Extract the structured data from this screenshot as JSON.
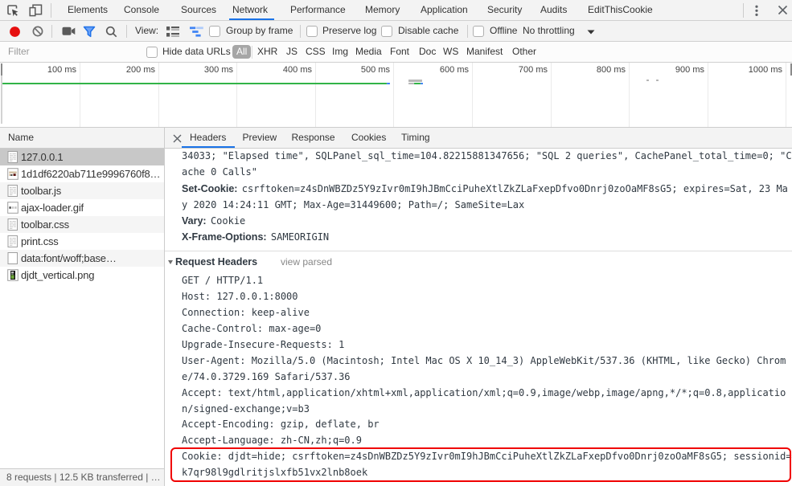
{
  "main_tabs": {
    "tabs": [
      "Elements",
      "Console",
      "Sources",
      "Network",
      "Performance",
      "Memory",
      "Application",
      "Security",
      "Audits",
      "EditThisCookie"
    ],
    "active": "Network"
  },
  "toolbar": {
    "view_label": "View:",
    "group_by_frame": "Group by frame",
    "preserve_log": "Preserve log",
    "disable_cache": "Disable cache",
    "offline": "Offline",
    "throttling": "No throttling"
  },
  "filter_bar": {
    "placeholder": "Filter",
    "hide_data_urls": "Hide data URLs",
    "types": [
      "All",
      "XHR",
      "JS",
      "CSS",
      "Img",
      "Media",
      "Font",
      "Doc",
      "WS",
      "Manifest",
      "Other"
    ],
    "active_type": "All"
  },
  "overview": {
    "ruler_labels": [
      "100 ms",
      "200 ms",
      "300 ms",
      "400 ms",
      "500 ms",
      "600 ms",
      "700 ms",
      "800 ms",
      "900 ms",
      "1000 ms"
    ]
  },
  "sidebar": {
    "header": "Name",
    "requests": [
      {
        "name": "127.0.0.1",
        "icon": "document",
        "selected": true
      },
      {
        "name": "1d1df6220ab711e9996760f8…",
        "icon": "image-photo",
        "selected": false
      },
      {
        "name": "toolbar.js",
        "icon": "document",
        "selected": false
      },
      {
        "name": "ajax-loader.gif",
        "icon": "image-loader",
        "selected": false
      },
      {
        "name": "toolbar.css",
        "icon": "document",
        "selected": false
      },
      {
        "name": "print.css",
        "icon": "document",
        "selected": false
      },
      {
        "name": "data:font/woff;base…",
        "icon": "blank",
        "selected": false
      },
      {
        "name": "djdt_vertical.png",
        "icon": "image-dark",
        "selected": false
      }
    ],
    "summary": "8 requests | 12.5 KB transferred | …"
  },
  "details": {
    "tabs": [
      "Headers",
      "Preview",
      "Response",
      "Cookies",
      "Timing"
    ],
    "active": "Headers",
    "response_lines": [
      {
        "text": "34033; \"Elapsed time\", SQLPanel_sql_time=104.82215881347656; \"SQL 2 queries\", CachePanel_total_time=0; \"C"
      },
      {
        "text": "ache 0 Calls\""
      },
      {
        "name": "Set-Cookie:",
        "text": "csrftoken=z4sDnWBZDz5Y9zIvr0mI9hJBmCciPuheXtlZkZLaFxepDfvo0Dnrj0zoOaMF8sG5; expires=Sat, 23 Ma"
      },
      {
        "text": "y 2020 14:24:11 GMT; Max-Age=31449600; Path=/; SameSite=Lax"
      },
      {
        "name": "Vary:",
        "text": "Cookie"
      },
      {
        "name": "X-Frame-Options:",
        "text": "SAMEORIGIN"
      }
    ],
    "request_section": {
      "title": "Request Headers",
      "link": "view parsed"
    },
    "request_lines": [
      "GET / HTTP/1.1",
      "Host: 127.0.0.1:8000",
      "Connection: keep-alive",
      "Cache-Control: max-age=0",
      "Upgrade-Insecure-Requests: 1",
      "User-Agent: Mozilla/5.0 (Macintosh; Intel Mac OS X 10_14_3) AppleWebKit/537.36 (KHTML, like Gecko) Chrom",
      "e/74.0.3729.169 Safari/537.36",
      "Accept: text/html,application/xhtml+xml,application/xml;q=0.9,image/webp,image/apng,*/*;q=0.8,applicatio",
      "n/signed-exchange;v=b3",
      "Accept-Encoding: gzip, deflate, br",
      "Accept-Language: zh-CN,zh;q=0.9",
      "Cookie: djdt=hide; csrftoken=z4sDnWBZDz5Y9zIvr0mI9hJBmCciPuheXtlZkZLaFxepDfvo0Dnrj0zoOaMF8sG5; sessionid=",
      "k7qr98l9gdlritjslxfb51vx2lnb8oek"
    ],
    "highlight_color": "#f00000"
  },
  "colors": {
    "accent_blue": "#1a73e8",
    "record_red": "#e60f0f",
    "waterfall_green": "#32b448",
    "waterfall_blue": "#3e82f1",
    "waterfall_gray": "#b8b8b8",
    "toolbar_bg": "#f3f3f3",
    "selected_row_gray": "#c8c8c8",
    "row_stripe": "#f5f5f5",
    "highlight_red": "#f00000"
  },
  "icons": {
    "inspect-element-icon": "cursor-in-box",
    "device-toolbar-icon": "phone-and-tablet",
    "more-options-icon": "vertical-ellipsis",
    "close-devtools-icon": "x-cross",
    "record-network-log-icon": "filled-red-circle",
    "clear-network-log-icon": "circle-with-slash",
    "capture-screenshots-icon": "video-camera",
    "filter-icon": "funnel",
    "search-icon": "magnifier",
    "large-request-rows-icon": "bulleted-list",
    "show-overview-icon": "waterfall-bars",
    "throttling-dropdown-icon": "triangle-down",
    "collapse-triangle-icon": "triangle-down",
    "close-details-icon": "x-cross",
    "file-document-icon": "page-with-text-lines",
    "file-image-icon": "image-thumbnail",
    "file-generic-icon": "blank-page"
  }
}
